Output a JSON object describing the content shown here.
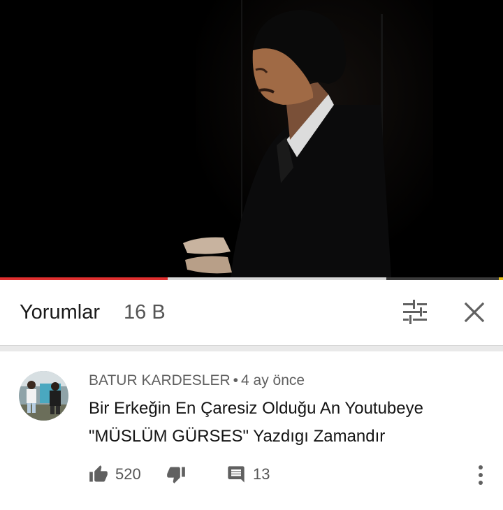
{
  "player": {
    "played_fraction": 0.333,
    "buffered_fraction": 0.768
  },
  "comments_panel": {
    "title": "Yorumlar",
    "count": "16 B",
    "sort_icon": "tune-icon",
    "close_icon": "close-icon"
  },
  "comment": {
    "author": "BATUR KARDESLER",
    "separator": "•",
    "time": "4 ay önce",
    "text_line1": "Bir Erkeğin En Çaresiz Olduğu An Youtubeye",
    "text_line2": "\"MÜSLÜM GÜRSES\" Yazdıgı Zamandır",
    "likes": "520",
    "replies": "13",
    "like_icon": "thumb-up-icon",
    "dislike_icon": "thumb-down-icon",
    "reply_icon": "comment-icon",
    "more_icon": "more-vert-icon"
  },
  "colors": {
    "progress_played": "#e02f2f",
    "progress_buffered": "#d9d9d9",
    "text_primary": "#141414",
    "text_secondary": "#606060"
  }
}
